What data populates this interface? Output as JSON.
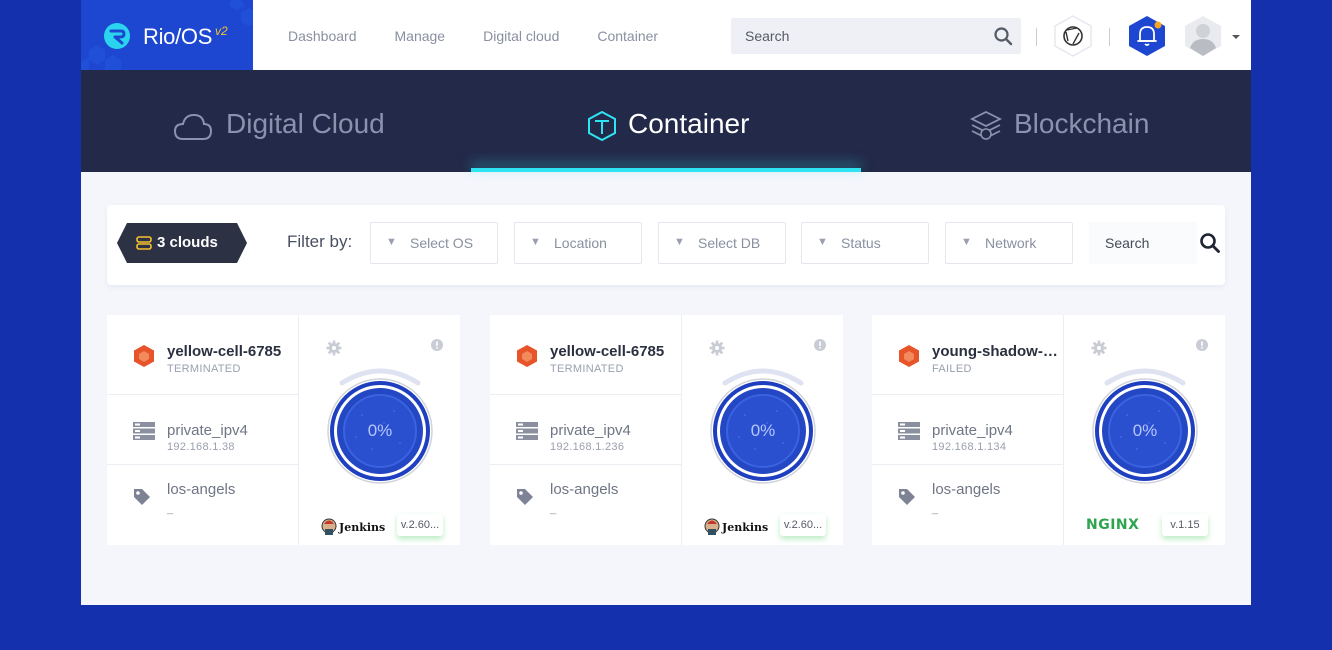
{
  "brand": {
    "name": "Rio/OS",
    "version": "v2"
  },
  "nav": [
    "Dashboard",
    "Manage",
    "Digital cloud",
    "Container"
  ],
  "search": {
    "placeholder": "Search"
  },
  "product_tabs": [
    {
      "label": "Digital Cloud",
      "icon": "cloud-icon",
      "active": false
    },
    {
      "label": "Container",
      "icon": "cube-icon",
      "active": true
    },
    {
      "label": "Blockchain",
      "icon": "blockchain-icon",
      "active": false
    }
  ],
  "filter": {
    "cloud_count": "3 clouds",
    "label": "Filter by:",
    "selects": [
      "Select OS",
      "Location",
      "Select DB",
      "Status",
      "Network"
    ],
    "search_placeholder": "Search"
  },
  "cards": [
    {
      "name": "yellow-cell-6785",
      "status": "TERMINATED",
      "network": "private_ipv4",
      "ip": "192.168.1.38",
      "location": "los-angels",
      "location_sub": "_",
      "progress": "0%",
      "app": "Jenkins",
      "app_version": "v.2.60..."
    },
    {
      "name": "yellow-cell-6785",
      "status": "TERMINATED",
      "network": "private_ipv4",
      "ip": "192.168.1.236",
      "location": "los-angels",
      "location_sub": "_",
      "progress": "0%",
      "app": "Jenkins",
      "app_version": "v.2.60..."
    },
    {
      "name": "young-shadow-7...",
      "status": "FAILED",
      "network": "private_ipv4",
      "ip": "192.168.1.134",
      "location": "los-angels",
      "location_sub": "_",
      "progress": "0%",
      "app": "NGINX",
      "app_version": "v.1.15"
    }
  ],
  "colors": {
    "page_bg": "#1530ac",
    "brand_bg": "#1d47d0",
    "tabs_bg": "#232948",
    "accent": "#2ee4f2",
    "status_hex": "#e8542a"
  }
}
